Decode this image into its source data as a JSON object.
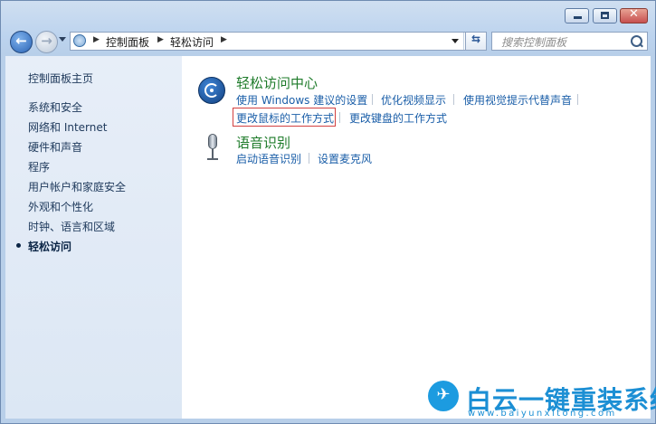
{
  "window": {
    "controls": {
      "minimize_icon": "minimize-icon",
      "maximize_icon": "maximize-icon",
      "close_icon": "close-icon",
      "close_glyph": "✕"
    }
  },
  "nav": {
    "back_glyph": "←",
    "forward_glyph": "→",
    "refresh_glyph": "⇆",
    "breadcrumb": [
      "控制面板",
      "轻松访问"
    ],
    "search_placeholder": "搜索控制面板"
  },
  "sidebar": {
    "items": [
      {
        "label": "控制面板主页",
        "current": false
      },
      {
        "label": "系统和安全",
        "current": false
      },
      {
        "label": "网络和 Internet",
        "current": false
      },
      {
        "label": "硬件和声音",
        "current": false
      },
      {
        "label": "程序",
        "current": false
      },
      {
        "label": "用户帐户和家庭安全",
        "current": false
      },
      {
        "label": "外观和个性化",
        "current": false
      },
      {
        "label": "时钟、语言和区域",
        "current": false
      },
      {
        "label": "轻松访问",
        "current": true
      }
    ]
  },
  "main": {
    "categories": [
      {
        "title": "轻松访问中心",
        "icon": "ease-of-access-icon",
        "links": [
          "使用 Windows 建议的设置",
          "优化视频显示",
          "使用视觉提示代替声音",
          "更改鼠标的工作方式",
          "更改键盘的工作方式"
        ],
        "highlighted_link": "更改鼠标的工作方式"
      },
      {
        "title": "语音识别",
        "icon": "microphone-icon",
        "links": [
          "启动语音识别",
          "设置麦克风"
        ]
      }
    ]
  },
  "watermark": {
    "brand": "白云一键重装系统",
    "url": "www.baiyunxitong.com",
    "logo_icon": "bird-logo-icon",
    "color": "#1c8fd4"
  },
  "colors": {
    "link": "#1a5ea8",
    "category_title": "#1e7b2a",
    "highlight_border": "#d24040"
  }
}
